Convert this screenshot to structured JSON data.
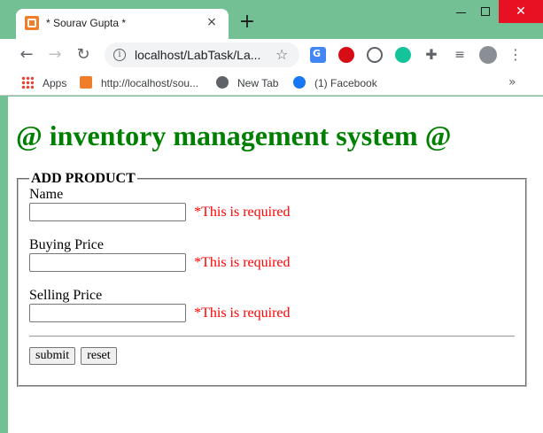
{
  "browser": {
    "tab_title": "* Sourav Gupta *",
    "tab_close": "×",
    "new_tab": "+",
    "url": "localhost/LabTask/La...",
    "window_close": "✕"
  },
  "bookmarks": [
    {
      "label": "Apps"
    },
    {
      "label": "http://localhost/sou..."
    },
    {
      "label": "New Tab"
    },
    {
      "label": "(1) Facebook"
    }
  ],
  "bookmarks_more": "»",
  "page": {
    "title": "@ inventory management system @"
  },
  "form": {
    "legend": "ADD PRODUCT",
    "fields": [
      {
        "label": "Name",
        "value": "",
        "error": "*This is required"
      },
      {
        "label": "Buying Price",
        "value": "",
        "error": "*This is required"
      },
      {
        "label": "Selling Price",
        "value": "",
        "error": "*This is required"
      }
    ],
    "submit_label": "submit",
    "reset_label": "reset"
  },
  "colors": {
    "window_frame": "#74c095",
    "title_green": "#008000",
    "error_red": "#ff0000",
    "close_red": "#e81123"
  }
}
